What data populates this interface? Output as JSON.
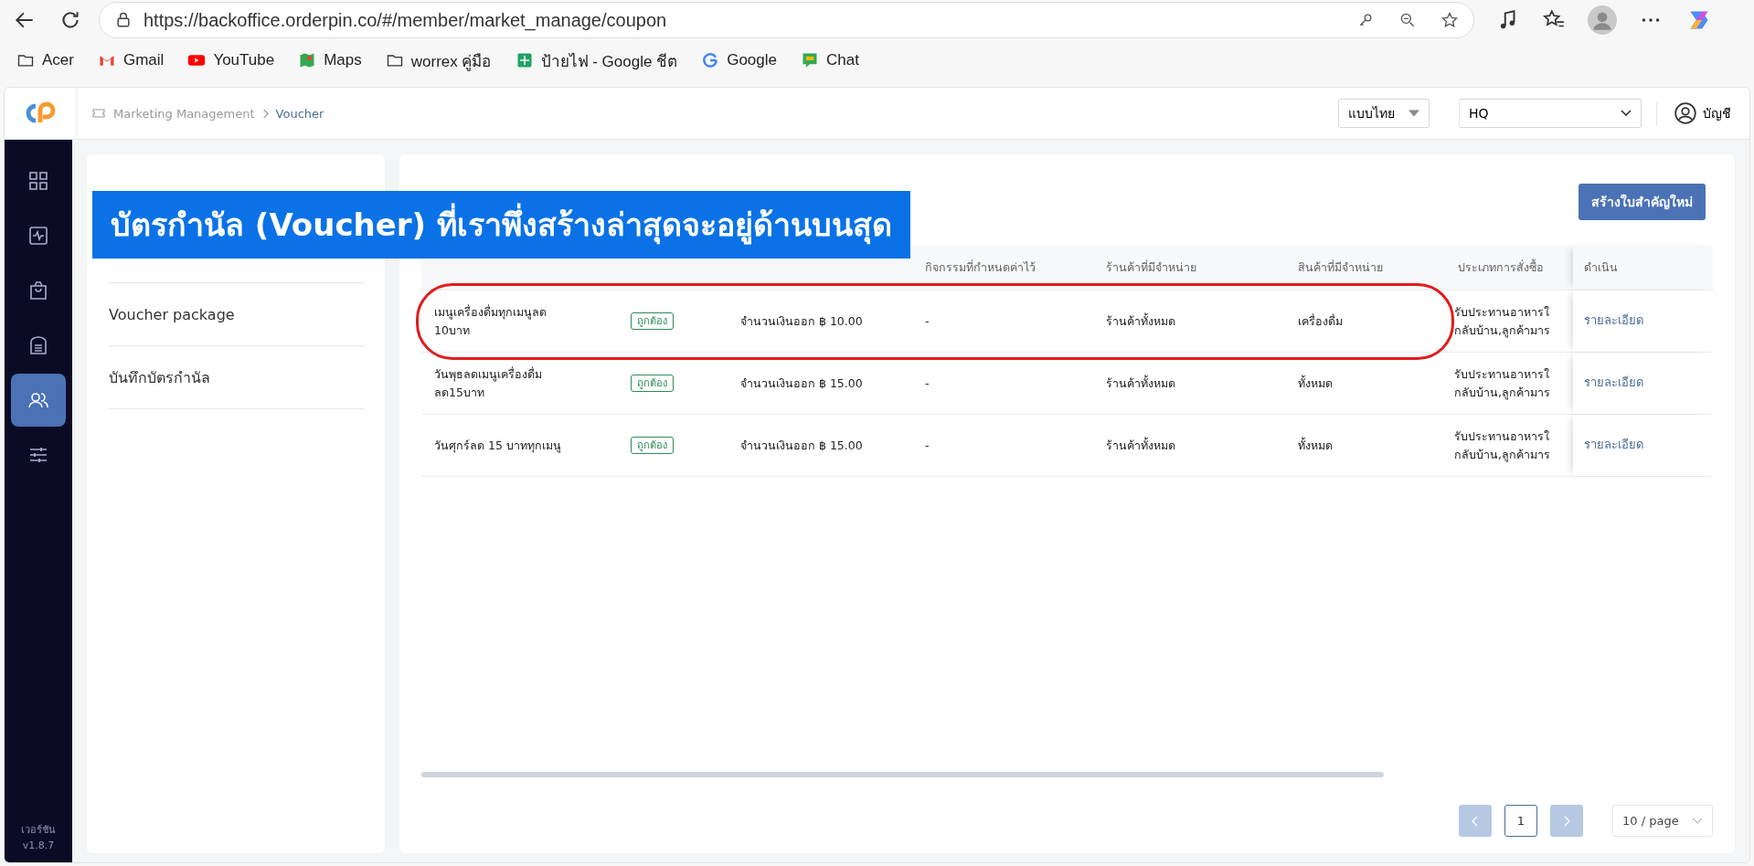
{
  "browser": {
    "url": "https://backoffice.orderpin.co/#/member/market_manage/coupon",
    "bookmarks": [
      {
        "label": "Acer",
        "kind": "folder"
      },
      {
        "label": "Gmail",
        "kind": "gmail"
      },
      {
        "label": "YouTube",
        "kind": "youtube"
      },
      {
        "label": "Maps",
        "kind": "maps"
      },
      {
        "label": "worrex คู่มือ",
        "kind": "folder"
      },
      {
        "label": "ป้ายไฟ - Google ชีต",
        "kind": "sheets"
      },
      {
        "label": "Google",
        "kind": "google"
      },
      {
        "label": "Chat",
        "kind": "chat"
      }
    ]
  },
  "header": {
    "breadcrumb": [
      "Marketing Management",
      "Voucher"
    ],
    "language": "แบบไทย",
    "branch": "HQ",
    "account": "บัญชี"
  },
  "sidebar": {
    "items": [
      {
        "kind": "grid",
        "selected": false
      },
      {
        "kind": "activity",
        "selected": false
      },
      {
        "kind": "bag",
        "selected": false
      },
      {
        "kind": "archive",
        "selected": false
      },
      {
        "kind": "people",
        "selected": true
      },
      {
        "kind": "sliders",
        "selected": false
      }
    ],
    "version_label": "เวอร์ชัน",
    "version": "v1.8.7"
  },
  "submenu": {
    "items": [
      {
        "label": "Voucher package"
      },
      {
        "label": "บันทึกบัตรกำนัล"
      }
    ]
  },
  "banner": {
    "text": "บัตรกำนัล (Voucher) ที่เราพึ่งสร้างล่าสุดจะอยู่ด้านบนสุด"
  },
  "create_button": "สร้างใบสำคัญใหม่",
  "table": {
    "columns": [
      "กิจกรรมที่กำหนดค่าไว้",
      "ร้านค้าที่มีจำหน่าย",
      "สินค้าที่มีจำหน่าย",
      "ประเภทการสั่งซื้อ",
      "ดำเนิน"
    ],
    "rows": [
      {
        "name": "เมนูเครื่องดื่มทุกเมนูลด\n10บาท",
        "status": "ถูกต้อง",
        "type": "จำนวนเงินออก ฿ 10.00",
        "activity": "-",
        "stores": "ร้านค้าทั้งหมด",
        "products": "เครื่องดื่ม",
        "order_type": "รับประทานอาหารใ\nกลับบ้าน,ลูกค้ามาร",
        "action": "รายละเอียด",
        "highlighted": true
      },
      {
        "name": "วันพุธลดเมนูเครื่องดื่ม\nลด15บาท",
        "status": "ถูกต้อง",
        "type": "จำนวนเงินออก ฿ 15.00",
        "activity": "-",
        "stores": "ร้านค้าทั้งหมด",
        "products": "ทั้งหมด",
        "order_type": "รับประทานอาหารใ\nกลับบ้าน,ลูกค้ามาร",
        "action": "รายละเอียด",
        "highlighted": false
      },
      {
        "name": "วันศุกร์ลด 15 บาททุกเมนู",
        "status": "ถูกต้อง",
        "type": "จำนวนเงินออก ฿ 15.00",
        "activity": "-",
        "stores": "ร้านค้าทั้งหมด",
        "products": "ทั้งหมด",
        "order_type": "รับประทานอาหารใ\nกลับบ้าน,ลูกค้ามาร",
        "action": "รายละเอียด",
        "highlighted": false
      }
    ]
  },
  "pagination": {
    "page": "1",
    "page_size": "10 / page"
  }
}
